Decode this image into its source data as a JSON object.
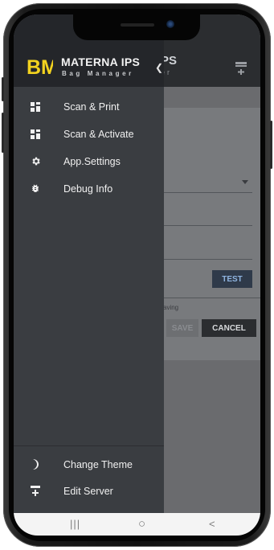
{
  "drawer": {
    "logo_text": "BM",
    "title": "MATERNA IPS",
    "subtitle": "Bag Manager",
    "collapse_icon": "chevron-left-icon",
    "items": [
      {
        "label": "Scan & Print",
        "icon": "grid-icon"
      },
      {
        "label": "Scan & Activate",
        "icon": "grid-icon"
      },
      {
        "label": "App.Settings",
        "icon": "gear-icon"
      },
      {
        "label": "Debug Info",
        "icon": "bug-icon"
      }
    ],
    "bottom_items": [
      {
        "label": "Change Theme",
        "icon": "moon-icon"
      },
      {
        "label": "Edit Server",
        "icon": "server-icon"
      }
    ]
  },
  "background_app": {
    "title_fragment": "PS",
    "subtitle_fragment": "er",
    "test_label": "TEST",
    "hint_fragment": "aving",
    "save_label": "SAVE",
    "cancel_label": "CANCEL"
  },
  "navbar": {
    "recents": "|||",
    "home": "○",
    "back": "<"
  },
  "colors": {
    "logo_yellow": "#f2d21f",
    "drawer_bg": "#3a3d41",
    "header_bg": "#24262a"
  }
}
